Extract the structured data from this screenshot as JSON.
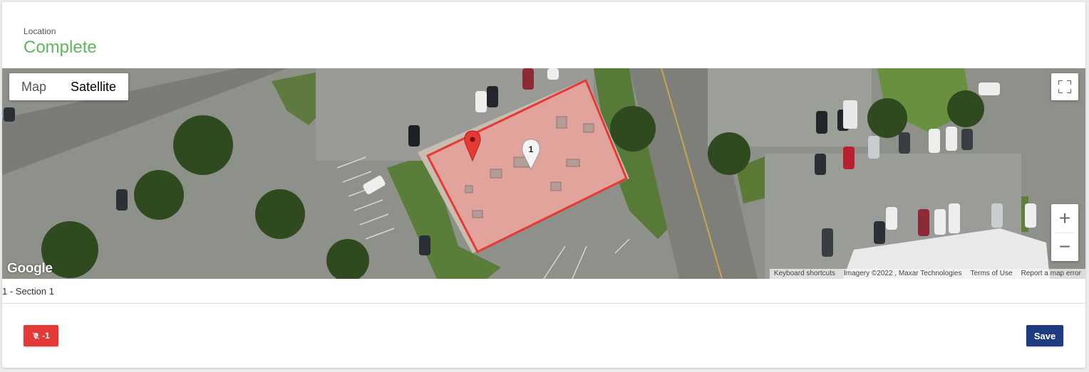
{
  "header": {
    "label": "Location",
    "status": "Complete",
    "status_color": "#5cb85c"
  },
  "map": {
    "type_options": [
      {
        "label": "Map",
        "selected": false
      },
      {
        "label": "Satellite",
        "selected": true
      }
    ],
    "marker_label": "1",
    "polygon_color": "#e53935",
    "logo_text": "Google",
    "attribution": {
      "shortcuts": "Keyboard shortcuts",
      "imagery": "Imagery ©2022 , Maxar Technologies",
      "terms": "Terms of Use",
      "report": "Report a map error"
    },
    "zoom_in": "+",
    "zoom_out": "−"
  },
  "caption": "1 - Section 1",
  "footer": {
    "remove_label": "-1",
    "remove_color": "#e53935",
    "save_label": "Save",
    "save_color": "#1e3a80"
  }
}
